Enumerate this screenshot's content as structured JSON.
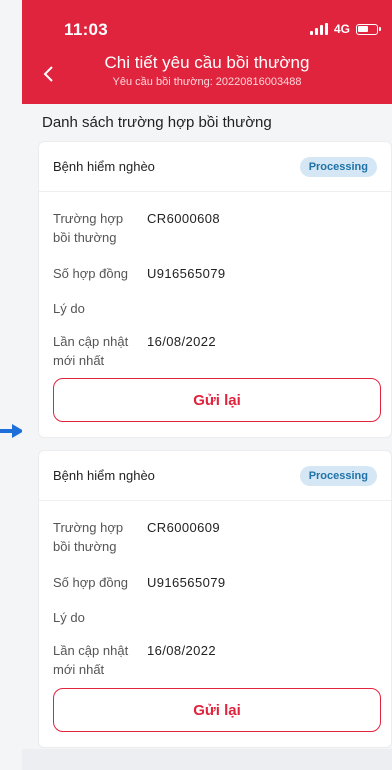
{
  "colors": {
    "brand": "#e0243d",
    "badge_bg": "#d5e7f4",
    "badge_text": "#1f73a8"
  },
  "status_bar": {
    "time": "11:03",
    "network": "4G",
    "icons": [
      "signal-icon",
      "battery-icon"
    ]
  },
  "header": {
    "back_icon": "chevron-left-icon",
    "title": "Chi tiết yêu cầu bồi thường",
    "subtitle": "Yêu cầu bồi thường: 20220816003488"
  },
  "section_title": "Danh sách trường hợp bồi thường",
  "claims": [
    {
      "type": "Bệnh hiểm nghèo",
      "status": "Processing",
      "case_label": "Trường hợp bồi thường",
      "case_value": "CR6000608",
      "contract_label": "Số hợp đồng",
      "contract_value": "U916565079",
      "reason_label": "Lý do",
      "updated_label": "Lần cập nhật mới nhất",
      "updated_value": "16/08/2022",
      "button_label": "Gửi lại"
    },
    {
      "type": "Bệnh hiểm nghèo",
      "status": "Processing",
      "case_label": "Trường hợp bồi thường",
      "case_value": "CR6000609",
      "contract_label": "Số hợp đồng",
      "contract_value": "U916565079",
      "reason_label": "Lý do",
      "updated_label": "Lần cập nhật mới nhất",
      "updated_value": "16/08/2022",
      "button_label": "Gửi lại"
    }
  ]
}
